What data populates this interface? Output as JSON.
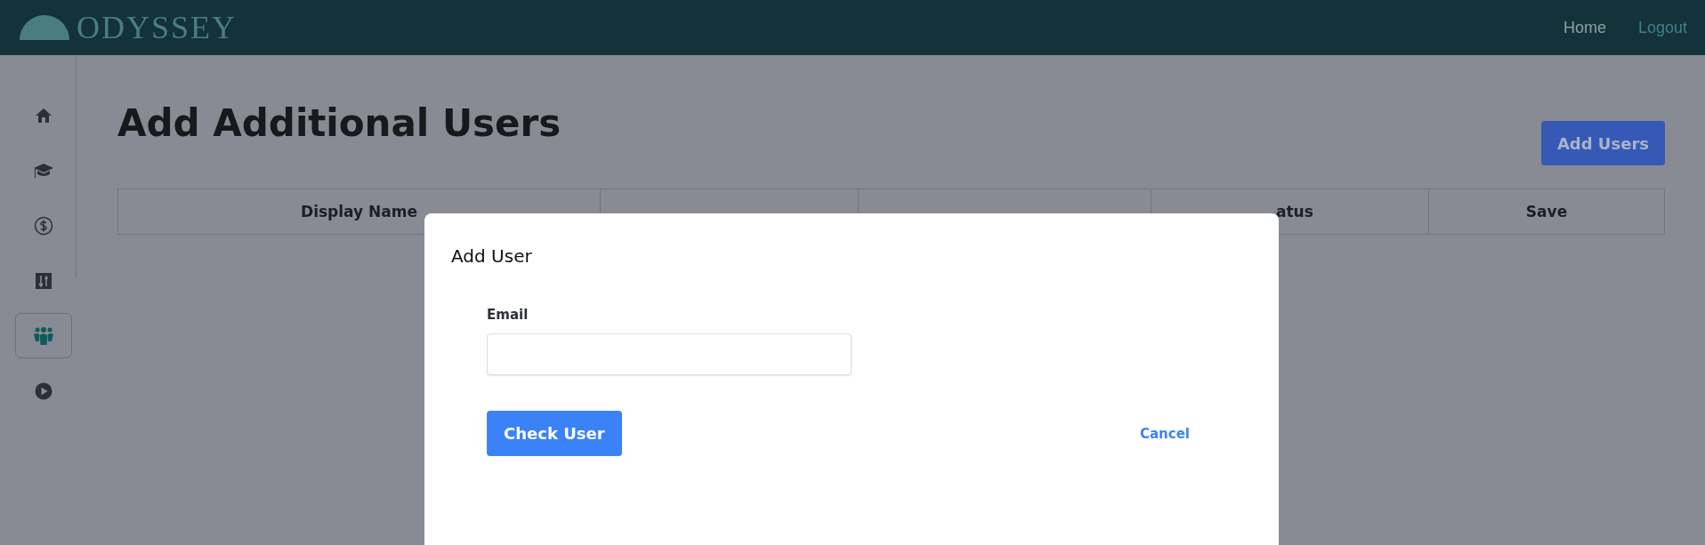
{
  "header": {
    "logo": "ODYSSEY",
    "nav": [
      {
        "label": "Home",
        "color": "#8fa1a6"
      },
      {
        "label": "Logout",
        "color": "#3d8389"
      }
    ]
  },
  "sidebar": {
    "items": [
      {
        "kind": "home",
        "selected": false
      },
      {
        "kind": "graduation",
        "selected": false
      },
      {
        "kind": "dollar",
        "selected": false
      },
      {
        "kind": "sliders",
        "selected": false
      },
      {
        "kind": "users",
        "selected": true
      },
      {
        "kind": "play",
        "selected": false
      }
    ]
  },
  "page": {
    "title": "Add Additional Users",
    "add_button": "Add Users"
  },
  "table": {
    "columns": [
      {
        "label": "Display Name"
      },
      {},
      {},
      {
        "label": "atus"
      },
      {
        "label": "Save"
      }
    ]
  },
  "modal": {
    "title": "Add User",
    "email_label": "Email",
    "submit": "Check User",
    "cancel": "Cancel"
  }
}
